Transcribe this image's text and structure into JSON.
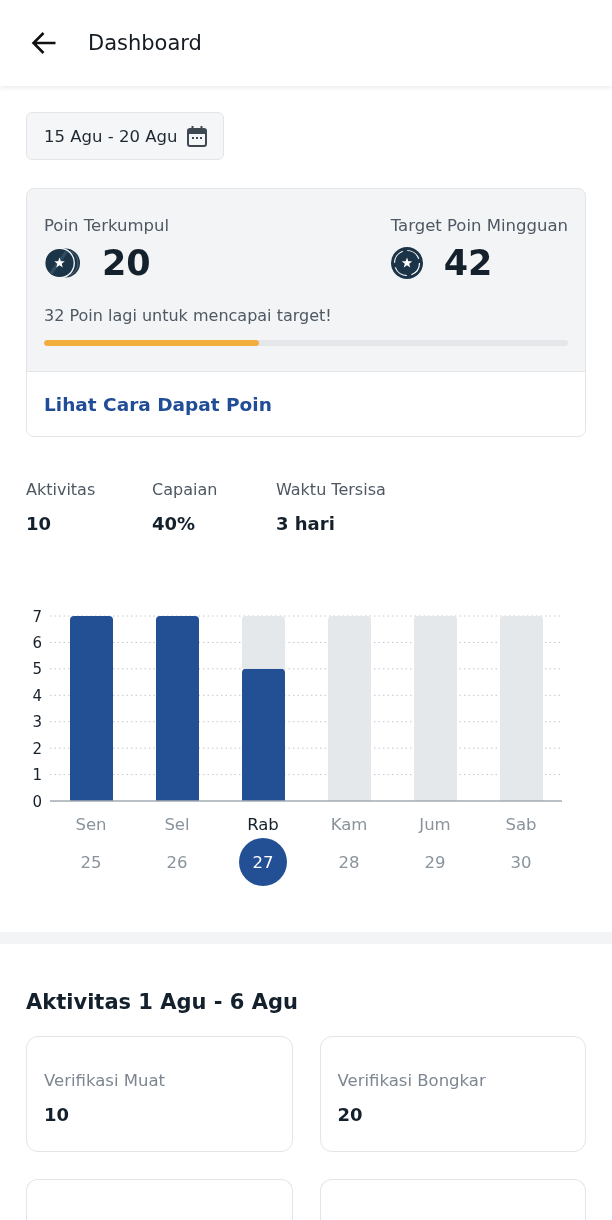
{
  "header": {
    "title": "Dashboard"
  },
  "date_range": {
    "label": "15 Agu - 20 Agu"
  },
  "points": {
    "collected": {
      "label": "Poin Terkumpul",
      "value": "20"
    },
    "target": {
      "label": "Target Poin Mingguan",
      "value": "42"
    },
    "message": "32 Poin lagi untuk mencapai target!",
    "progress": {
      "level": 0.41
    },
    "link": "Lihat Cara Dapat Poin"
  },
  "stats": [
    {
      "label": "Aktivitas",
      "value": "10"
    },
    {
      "label": "Capaian",
      "value": "40%"
    },
    {
      "label": "Waktu Tersisa",
      "value": "3 hari"
    }
  ],
  "activity_chart": {
    "chart_data": {
      "type": "bar",
      "categories": [
        "Sen",
        "Sel",
        "Rab",
        "Kam",
        "Jum",
        "Sab"
      ],
      "series": [
        {
          "color": "#234f95",
          "values": [
            7,
            7,
            5,
            null,
            null,
            null
          ]
        },
        {
          "color": "#e5e8eb",
          "values": [
            null,
            null,
            2,
            7,
            7,
            7
          ]
        }
      ],
      "stacked": true,
      "ylim": [
        0,
        7
      ],
      "yticks": [
        0,
        1,
        2,
        3,
        4,
        5,
        6,
        7
      ],
      "grid": true
    },
    "days": [
      {
        "date": "25",
        "selected": false
      },
      {
        "date": "26",
        "selected": false
      },
      {
        "date": "27",
        "selected": true
      },
      {
        "date": "28",
        "selected": false
      },
      {
        "date": "29",
        "selected": false
      },
      {
        "date": "30",
        "selected": false
      }
    ]
  },
  "activities": {
    "title": "Aktivitas 1 Agu - 6 Agu",
    "cards": [
      {
        "kind": "stat",
        "label": "Verifikasi Muat",
        "value": "10"
      },
      {
        "kind": "stat",
        "label": "Verifikasi Bongkar",
        "value": "20"
      },
      {
        "kind": "cut-off"
      },
      {
        "kind": "cut-off"
      }
    ]
  }
}
